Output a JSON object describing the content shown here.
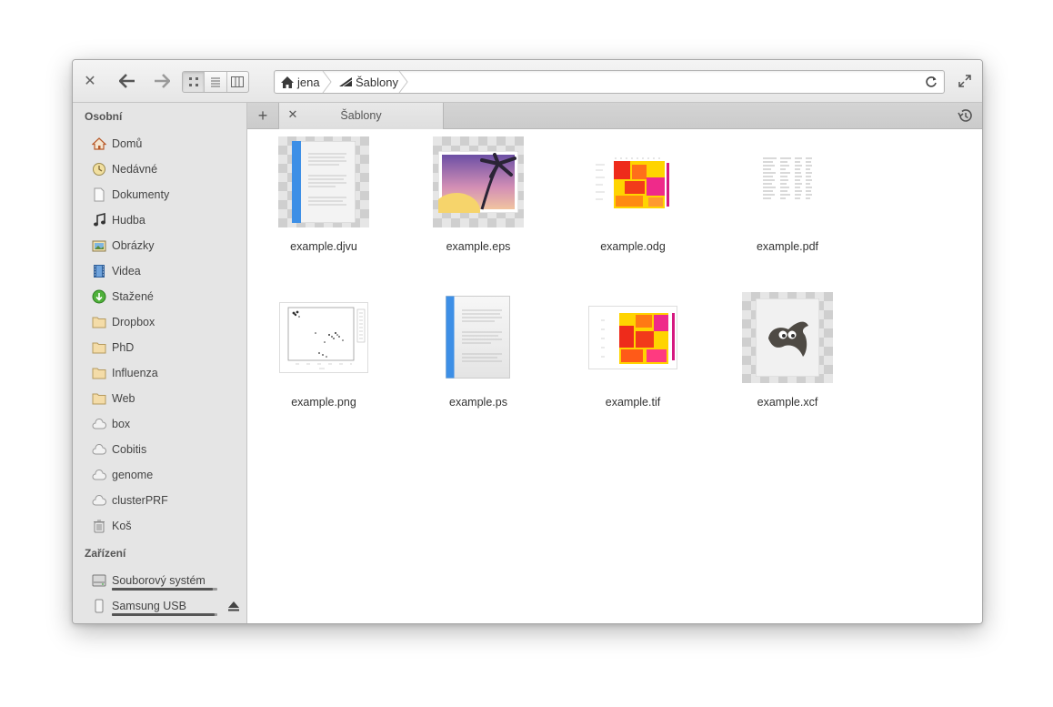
{
  "headerbar": {
    "path": [
      {
        "label": "jena",
        "icon": "home-icon"
      },
      {
        "label": "Šablony",
        "icon": "templates-icon"
      }
    ]
  },
  "sidebar": {
    "personal_heading": "Osobní",
    "personal": [
      {
        "label": "Domů",
        "icon": "home-icon"
      },
      {
        "label": "Nedávné",
        "icon": "recent-icon"
      },
      {
        "label": "Dokumenty",
        "icon": "document-icon"
      },
      {
        "label": "Hudba",
        "icon": "music-icon"
      },
      {
        "label": "Obrázky",
        "icon": "pictures-icon"
      },
      {
        "label": "Videa",
        "icon": "video-icon"
      },
      {
        "label": "Stažené",
        "icon": "download-icon"
      },
      {
        "label": "Dropbox",
        "icon": "folder-icon"
      },
      {
        "label": "PhD",
        "icon": "folder-icon"
      },
      {
        "label": "Influenza",
        "icon": "folder-icon"
      },
      {
        "label": "Web",
        "icon": "folder-icon"
      },
      {
        "label": "box",
        "icon": "cloud-icon"
      },
      {
        "label": "Cobitis",
        "icon": "cloud-icon"
      },
      {
        "label": "genome",
        "icon": "cloud-icon"
      },
      {
        "label": "clusterPRF",
        "icon": "cloud-icon"
      },
      {
        "label": "Koš",
        "icon": "trash-icon"
      }
    ],
    "devices_heading": "Zařízení",
    "devices": [
      {
        "label": "Souborový systém",
        "icon": "harddisk-icon",
        "usage": 0.96
      },
      {
        "label": "Samsung USB",
        "icon": "usb-drive-icon",
        "usage": 0.97
      }
    ]
  },
  "tabs": [
    {
      "label": "Šablony",
      "active": true
    }
  ],
  "files": [
    {
      "name": "example.djvu",
      "type": "djvu"
    },
    {
      "name": "example.eps",
      "type": "eps"
    },
    {
      "name": "example.odg",
      "type": "odg"
    },
    {
      "name": "example.pdf",
      "type": "pdf"
    },
    {
      "name": "example.png",
      "type": "png"
    },
    {
      "name": "example.ps",
      "type": "ps"
    },
    {
      "name": "example.tif",
      "type": "tif"
    },
    {
      "name": "example.xcf",
      "type": "xcf"
    }
  ],
  "colors": {
    "accent_blue": "#3d8fe6",
    "sidebar_bg": "#e5e5e5",
    "heatmap_hot": "#e8181e",
    "heatmap_warm": "#ffd400",
    "download_green": "#4fb13a"
  }
}
